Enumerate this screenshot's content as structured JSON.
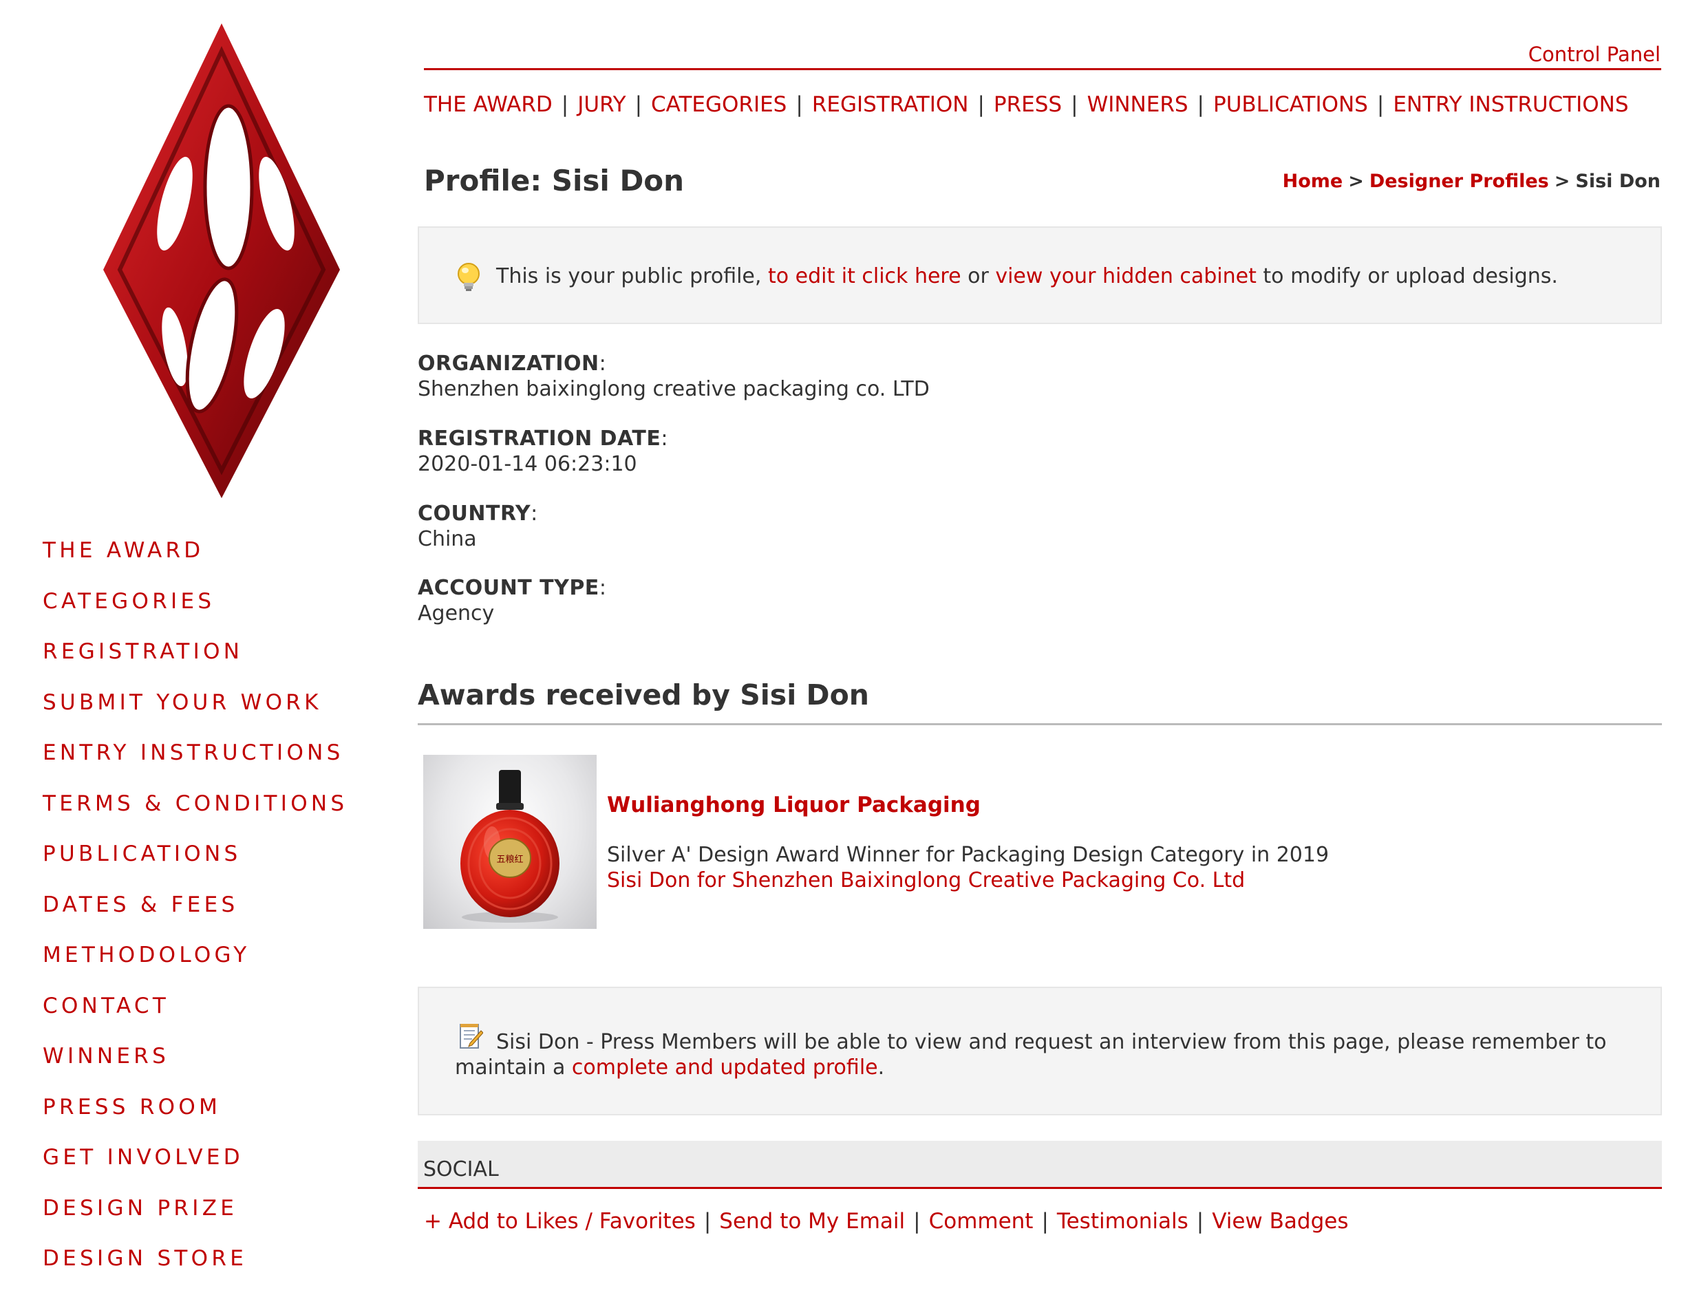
{
  "colors": {
    "accent": "#c00000",
    "text": "#333333",
    "box_bg": "#f4f4f4",
    "social_bg": "#ececec"
  },
  "sidebar": {
    "items": [
      {
        "label": "THE AWARD"
      },
      {
        "label": "CATEGORIES"
      },
      {
        "label": "REGISTRATION"
      },
      {
        "label": "SUBMIT YOUR WORK"
      },
      {
        "label": "ENTRY INSTRUCTIONS"
      },
      {
        "label": "TERMS & CONDITIONS"
      },
      {
        "label": "PUBLICATIONS"
      },
      {
        "label": "DATES & FEES"
      },
      {
        "label": "METHODOLOGY"
      },
      {
        "label": "CONTACT"
      },
      {
        "label": "WINNERS"
      },
      {
        "label": "PRESS ROOM"
      },
      {
        "label": "GET INVOLVED"
      },
      {
        "label": "DESIGN PRIZE"
      },
      {
        "label": "DESIGN STORE"
      }
    ]
  },
  "header": {
    "control_panel": "Control Panel",
    "nav": [
      {
        "label": "THE AWARD"
      },
      {
        "label": "JURY"
      },
      {
        "label": "CATEGORIES"
      },
      {
        "label": "REGISTRATION"
      },
      {
        "label": "PRESS"
      },
      {
        "label": "WINNERS"
      },
      {
        "label": "PUBLICATIONS"
      },
      {
        "label": "ENTRY INSTRUCTIONS"
      }
    ],
    "separator": "|"
  },
  "page": {
    "title": "Profile: Sisi Don",
    "breadcrumb": {
      "home": "Home",
      "profiles": "Designer Profiles",
      "current": "Sisi Don",
      "separator": ">"
    }
  },
  "notice": {
    "text_1": "This is your public profile, ",
    "link_edit": "to edit it click here",
    "text_2": " or ",
    "link_cabinet": "view your hidden cabinet",
    "text_3": " to modify or upload designs."
  },
  "profile": {
    "organization": {
      "label": "ORGANIZATION",
      "value": "Shenzhen baixinglong creative packaging co. LTD"
    },
    "registration_date": {
      "label": "REGISTRATION DATE",
      "value": "2020-01-14 06:23:10"
    },
    "country": {
      "label": "COUNTRY",
      "value": "China"
    },
    "account_type": {
      "label": "ACCOUNT TYPE",
      "value": "Agency"
    },
    "colon": ":"
  },
  "awards": {
    "heading": "Awards received by Sisi Don",
    "items": [
      {
        "title": "Wulianghong Liquor Packaging",
        "description": "Silver A' Design Award Winner for Packaging Design Category in 2019",
        "designer": "Sisi Don for Shenzhen Baixinglong Creative Packaging Co. Ltd",
        "image_label": "五粮红"
      }
    ]
  },
  "press": {
    "text": "Sisi Don - Press Members will be able to view and request an interview from this page, please remember to maintain a ",
    "link": "complete and updated profile",
    "end": "."
  },
  "social": {
    "heading": "SOCIAL",
    "links": [
      {
        "label": "+ Add to Likes / Favorites"
      },
      {
        "label": "Send to My Email"
      },
      {
        "label": "Comment"
      },
      {
        "label": "Testimonials"
      },
      {
        "label": "View Badges"
      }
    ]
  }
}
